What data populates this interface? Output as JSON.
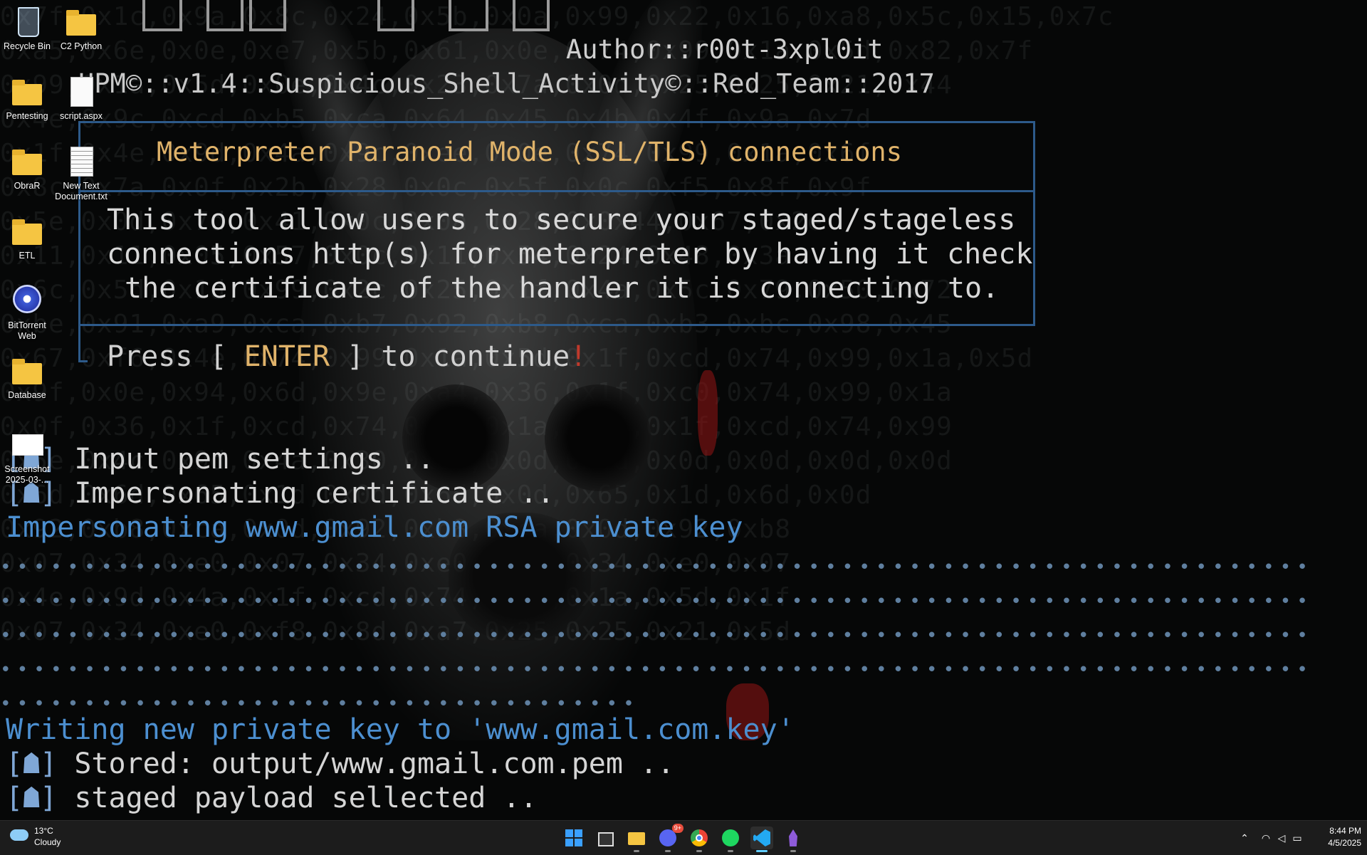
{
  "desktop": {
    "icons": [
      {
        "label": "Recycle Bin",
        "icon": "recycle-bin-icon"
      },
      {
        "label": "C2 Python",
        "icon": "folder-icon"
      },
      {
        "label": "Pentesting",
        "icon": "folder-icon"
      },
      {
        "label": "script.aspx",
        "icon": "file-icon"
      },
      {
        "label": "ObraR",
        "icon": "folder-icon"
      },
      {
        "label": "New Text Document.txt",
        "icon": "text-file-icon"
      },
      {
        "label": "ETL",
        "icon": "folder-icon"
      },
      {
        "label": "BitTorrent Web",
        "icon": "bittorrent-icon"
      },
      {
        "label": "Database",
        "icon": "folder-icon"
      },
      {
        "label": "Screenshot 2025-03-...",
        "icon": "image-file-icon"
      }
    ]
  },
  "terminal": {
    "author": "Author::r00t-3xpl0it",
    "version_line": "UPM©::v1.4::Suspicious_Shell_Activity©::Red_Team::2017",
    "banner_title": "Meterpreter Paranoid Mode (SSL/TLS) connections",
    "description": [
      "This tool allow users to secure your staged/stageless",
      "connections http(s) for meterpreter by having it check",
      "the certificate of the handler it is connecting to."
    ],
    "press": {
      "prefix": "Press [ ",
      "key": "ENTER",
      "suffix": " ] to continue",
      "bang": "!"
    },
    "log": [
      {
        "tag": "[☗]",
        "text": " Input pem settings .."
      },
      {
        "tag": "[☗]",
        "text": " Impersonating certificate .."
      },
      {
        "tag": "",
        "text": "Impersonating www.gmail.com RSA private key"
      },
      {
        "tag": "",
        "text": "Writing new private key to 'www.gmail.com.key'"
      },
      {
        "tag": "[☗]",
        "text": " Stored: output/www.gmail.com.pem .."
      },
      {
        "tag": "[☗]",
        "text": " staged payload sellected .."
      }
    ],
    "background_hex": [
      "0x7f,0x1c,0x9a,0x8c,0x24,0x5b,0x0a,0x99,0x22,0x16,0xa8,0x5c,0x15,0x7c",
      "0xa5,0x6e,0x0e,0xe7,0x5b,0x61,0x0e,0x74,0x99,0x1a,0x5d,0x82,0x7f",
      "0x99,0x1a,0x5d,0x0e,0x4c,0x23,0x7a,0x0d,0x25,0x25,0x21,0x44",
      "0x4e,0x9c,0xcd,0xb5,0xca,0x64,0x45,0x4b,0x4f,0x9a,0x7d",
      "0x1f,0x4e,0x9d,0x4a,0x9c,0xee,0x0e,0x74,0x99,0x1a,0x6f",
      "0x8c,0x7a,0x0f,0x2b,0x28,0x0c,0x5f,0x0c,0xf5,0x8f,0x9f",
      "0x5e,0x0d,0x7d,0x41,0x0c,0x0a,0x28,0x0x44,0x67,0x2e",
      "0x11,0x11,0x05,0x57,0x0c,0x11,0x54,0x24,0x48,0x3a",
      "0x6c,0x5d,0x1d,0x99,0x2c,0x25,0x1f,0x4a,0x5c,0x79,0x50,0x72",
      "0xbe,0x91,0xa9,0xca,0xb7,0x92,0xb8,0xca,0xb3,0xbc,0x98,0x45",
      "0x67,0xf6,0x4e,0x74,0x99,0x1a,0x5d,0x1f,0xcd,0x74,0x99,0x1a,0x5d",
      "0x9f,0x0e,0x94,0x6d,0x9e,0xa4,0x36,0x1f,0xc0,0x74,0x99,0x1a",
      "0x0f,0x36,0x1f,0xcd,0x74,0x99,0x1a,0x36,0x1f,0xcd,0x74,0x99",
      "0x5e,0x4c,0x9d,0x4a,0x30,0x0d,0x0d,0x0d,0x0d,0x0d,0x0d,0x0d",
      "0x6d,0x6d,0x65,0x1d,0x0d,0x6d,0x0d,0x65,0x1d,0x6d,0x0d",
      "0x92,0xb8,0xca,0x0d,0x92,0xb8,0xca,0x0d,0x92,0xb8",
      "0x07,0x34,0xe0,0x07,0x34,0xe0,0x07,0x34,0xe0,0x07",
      "0x4e,0x9d,0x4a,0x1f,0xcd,0x74,0x99,0x1a,0x5d,0x1f",
      "0x07,0x34,0xe0,0xf8,0x8d,0xa7,0x25,0x25,0x21,0x5d"
    ]
  },
  "taskbar": {
    "weather": {
      "temp": "13°C",
      "condition": "Cloudy"
    },
    "apps": [
      {
        "name": "Start",
        "icon": "windows-start-icon"
      },
      {
        "name": "Task View",
        "icon": "task-view-icon"
      },
      {
        "name": "File Explorer",
        "icon": "file-explorer-icon"
      },
      {
        "name": "Discord",
        "icon": "discord-icon",
        "badge": "9+"
      },
      {
        "name": "Google Chrome",
        "icon": "chrome-icon"
      },
      {
        "name": "Spotify",
        "icon": "spotify-icon"
      },
      {
        "name": "Visual Studio Code",
        "icon": "vscode-icon"
      },
      {
        "name": "Purple App",
        "icon": "purple-app-icon"
      }
    ],
    "clock": {
      "time": "8:44 PM",
      "date": "4/5/2025"
    }
  },
  "colors": {
    "banner_border": "#2d5a8a",
    "accent_yellow": "#e0b36a",
    "log_blue": "#4c8fd0",
    "taskbar_bg": "#1c1c1c"
  }
}
